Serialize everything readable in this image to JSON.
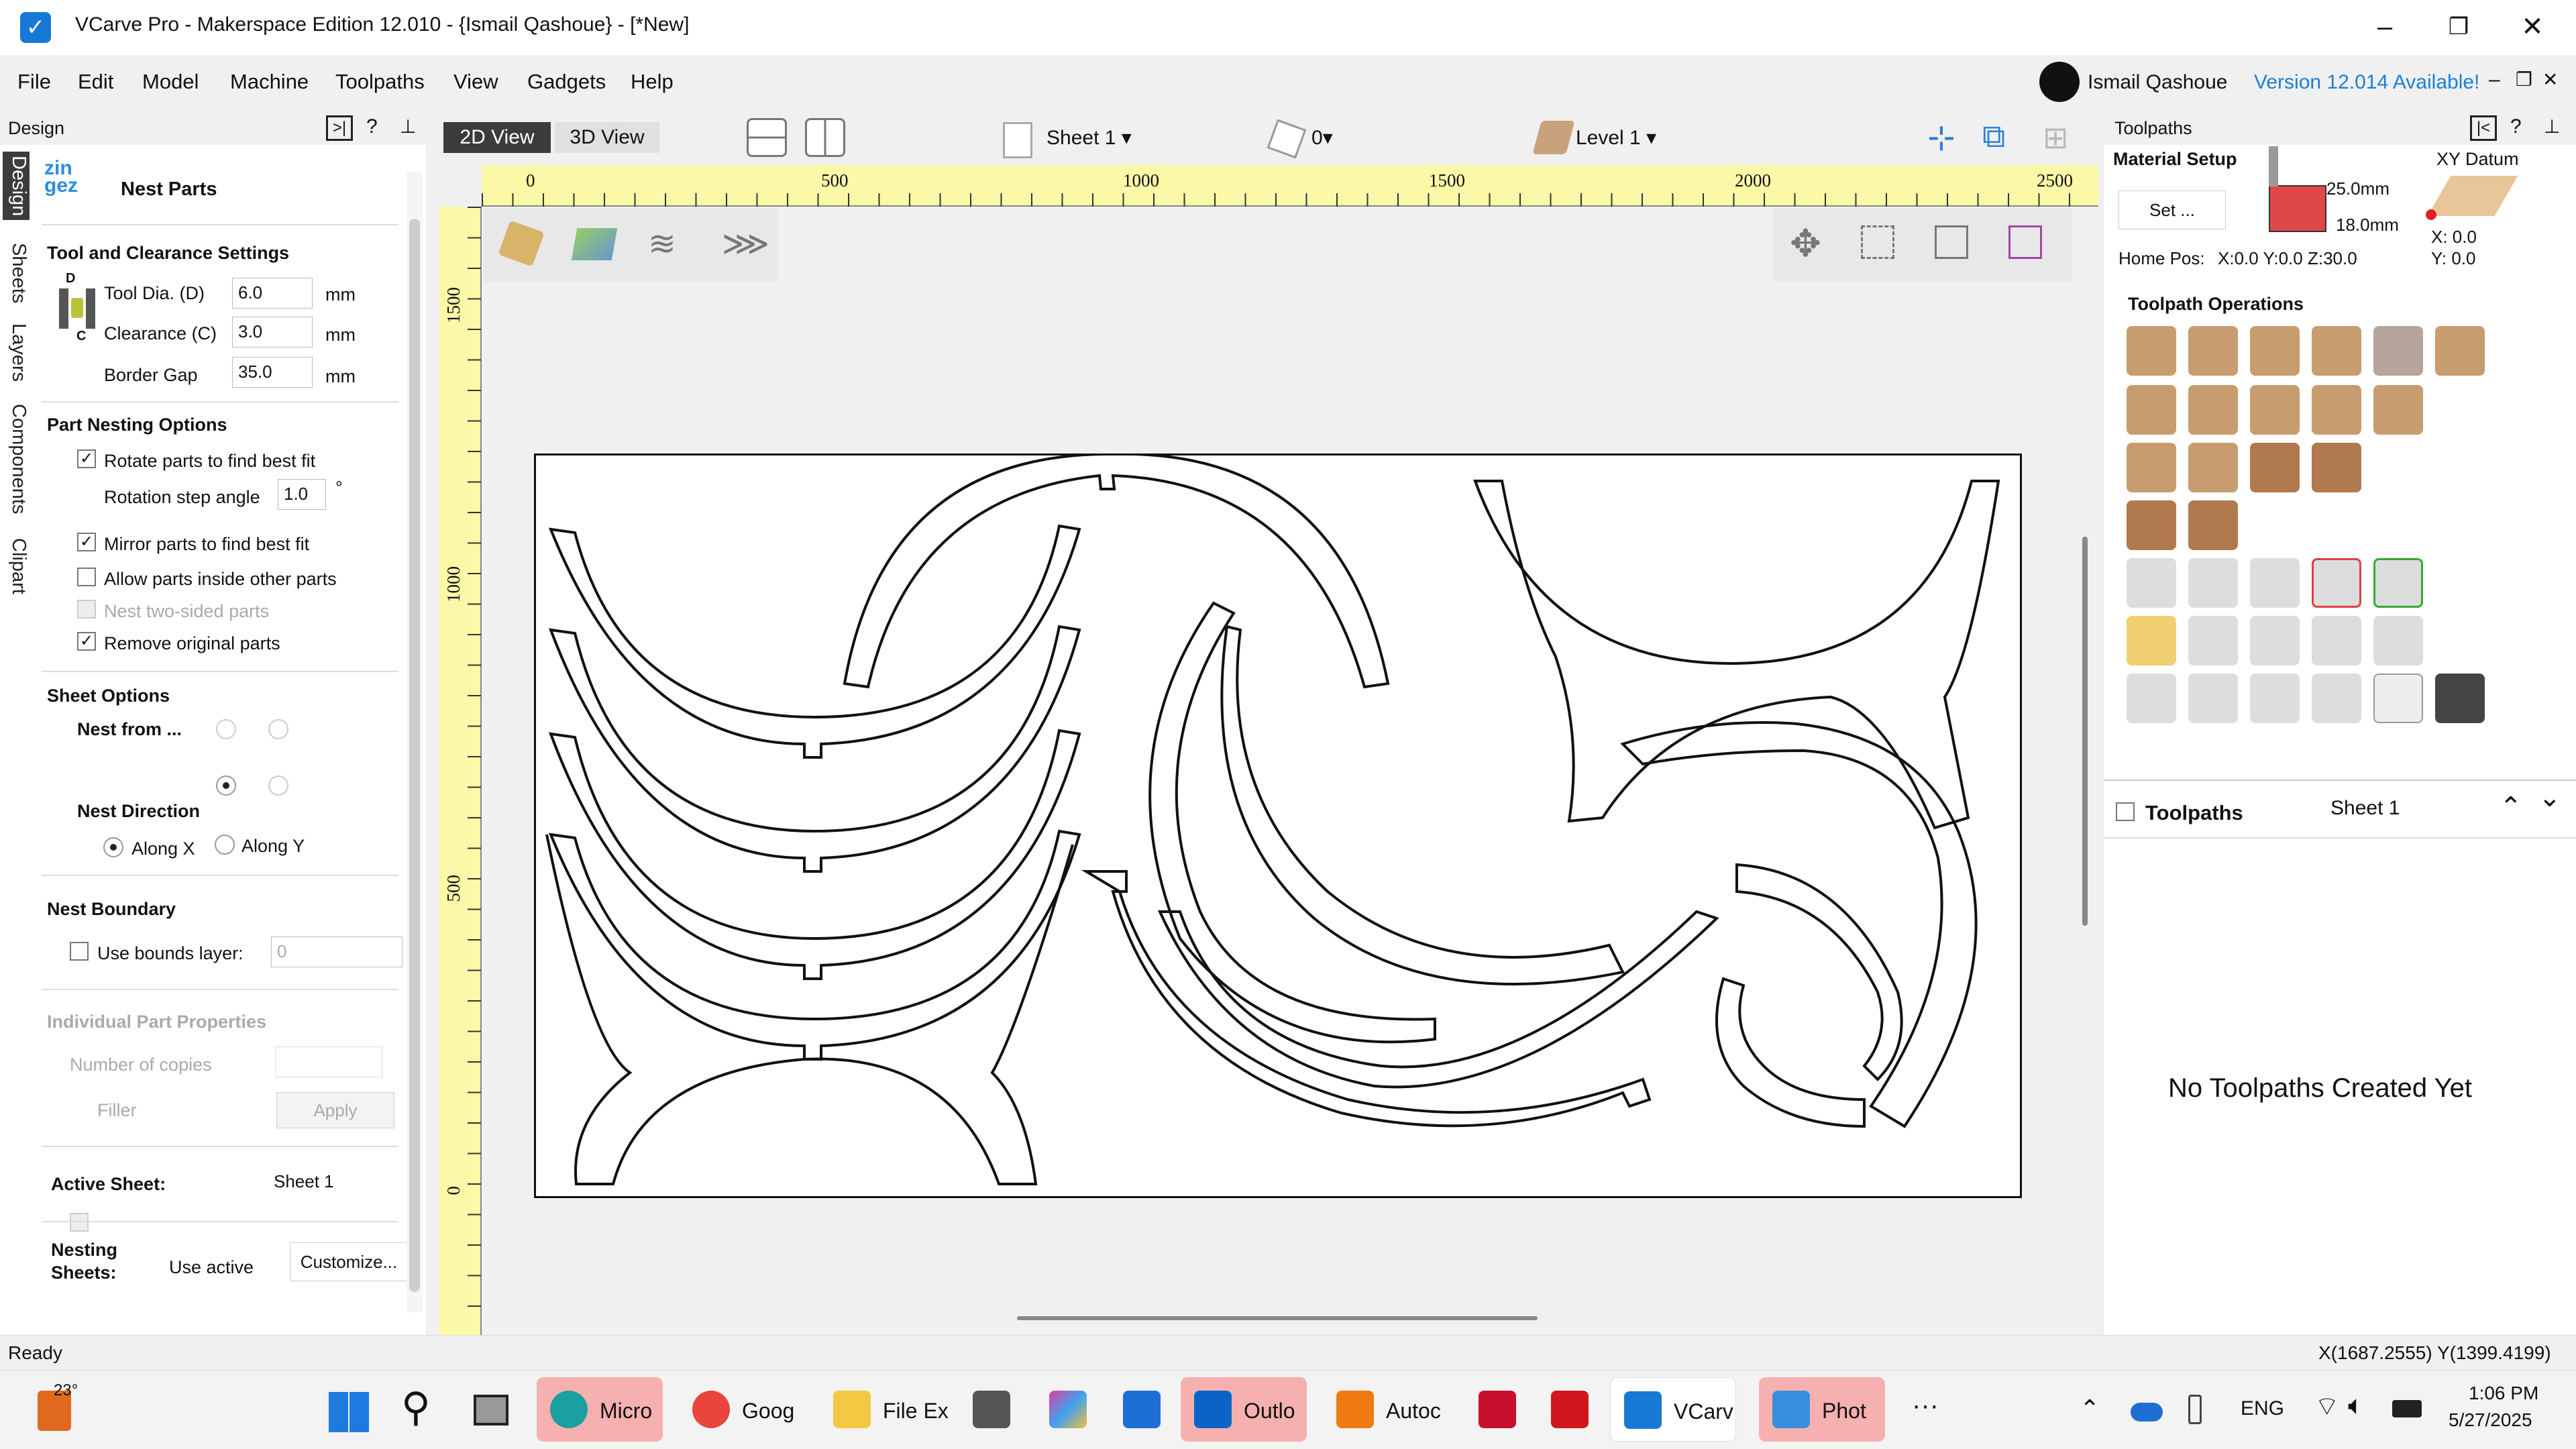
{
  "window": {
    "title": "VCarve Pro - Makerspace Edition 12.010 - {Ismail Qashoue} - [*New]"
  },
  "menu": [
    "File",
    "Edit",
    "Model",
    "Machine",
    "Toolpaths",
    "View",
    "Gadgets",
    "Help"
  ],
  "account": {
    "user": "Ismail Qashoue",
    "update": "Version 12.014 Available!"
  },
  "left_tabs": [
    "Design",
    "Sheets",
    "Layers",
    "Components",
    "Clipart"
  ],
  "design_panel": {
    "header": "Design",
    "title": "Nest Parts",
    "tool": {
      "heading": "Tool and Clearance Settings",
      "tool_dia_label": "Tool Dia. (D)",
      "tool_dia": "6.0",
      "clearance_label": "Clearance (C)",
      "clearance": "3.0",
      "border_label": "Border Gap",
      "border": "35.0",
      "unit": "mm",
      "diagram_d": "D",
      "diagram_c": "C"
    },
    "nesting": {
      "heading": "Part Nesting Options",
      "rotate": "Rotate parts to find best fit",
      "step_label": "Rotation step angle",
      "step": "1.0",
      "deg": "°",
      "mirror": "Mirror parts to find best fit",
      "inside": "Allow parts inside other parts",
      "twosided": "Nest two-sided parts",
      "remove": "Remove original parts"
    },
    "sheet": {
      "heading": "Sheet Options",
      "nest_from": "Nest from ...",
      "direction": "Nest Direction",
      "along_x": "Along X",
      "along_y": "Along Y"
    },
    "boundary": {
      "heading": "Nest Boundary",
      "use_bounds": "Use bounds layer:",
      "layer": "0"
    },
    "individual": {
      "heading": "Individual Part Properties",
      "copies": "Number of copies",
      "filler": "Filler",
      "apply": "Apply"
    },
    "active_sheet": {
      "label": "Active Sheet:",
      "value": "Sheet 1"
    },
    "nesting_sheets": {
      "label1": "Nesting",
      "label2": "Sheets:",
      "use": "Use active",
      "customize": "Customize..."
    }
  },
  "view": {
    "tab_2d": "2D View",
    "tab_3d": "3D View",
    "sheet": "Sheet 1",
    "layer_count": "0",
    "level": "Level 1",
    "ruler_x": [
      "0",
      "500",
      "1000",
      "1500",
      "2000",
      "2500"
    ],
    "ruler_y": [
      "1500",
      "1000",
      "500",
      "0"
    ]
  },
  "toolpaths_panel": {
    "header": "Toolpaths",
    "material_setup": "Material Setup",
    "set_button": "Set ...",
    "thickness": "25.0mm",
    "z_zero": "18.0mm",
    "xy_datum": "XY Datum",
    "datum_x": "X: 0.0",
    "datum_y": "Y: 0.0",
    "home_label": "Home Pos:",
    "home_value": "X:0.0 Y:0.0 Z:30.0",
    "ops_heading": "Toolpath Operations",
    "list_heading": "Toolpaths",
    "list_sheet": "Sheet 1",
    "empty": "No Toolpaths Created Yet"
  },
  "status": {
    "left": "Ready",
    "coords": "X(1687.2555) Y(1399.4199)"
  },
  "taskbar": {
    "weather": "23°",
    "apps": [
      "Micro",
      "Goog",
      "File Ex",
      "",
      "",
      "",
      "Outlo",
      "Autoc",
      "",
      "",
      "VCarv",
      "Phot"
    ],
    "lang": "ENG",
    "time": "1:06 PM",
    "date": "5/27/2025"
  }
}
